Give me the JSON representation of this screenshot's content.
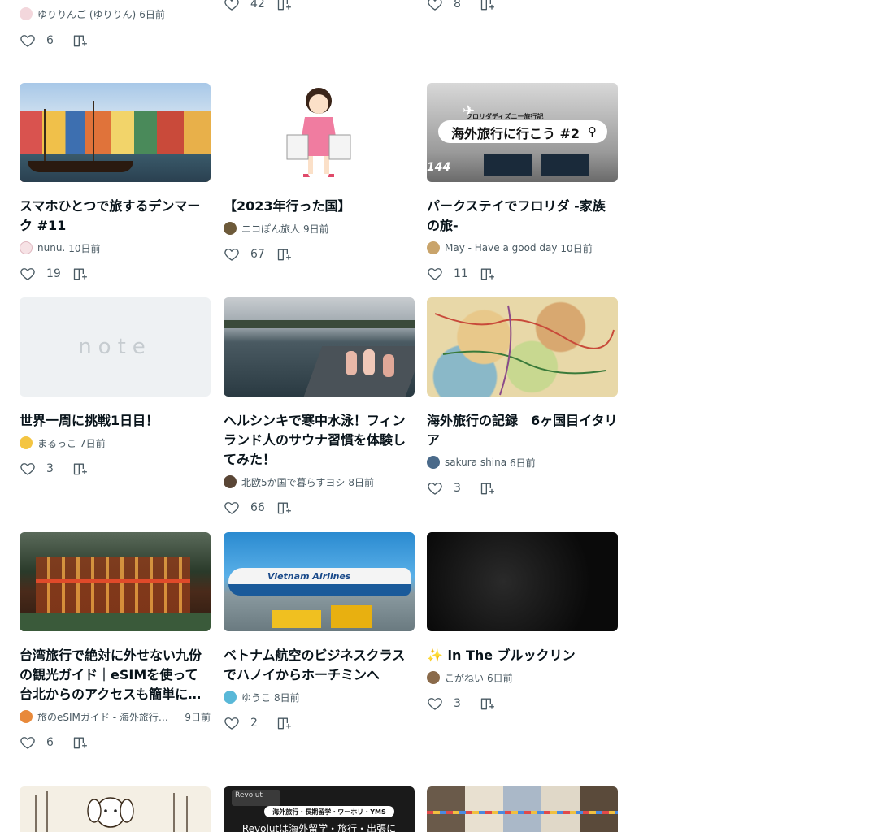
{
  "top_row": [
    {
      "author": "ゆりりんご (ゆりりん)",
      "time": "6日前",
      "likes": "6",
      "avatar_color": "#f3d7dc"
    },
    {
      "likes": "42"
    },
    {
      "likes": "8"
    }
  ],
  "row1": [
    {
      "title": "スマホひとつで旅するデンマーク #11",
      "author": "nunu.",
      "time": "10日前",
      "likes": "19",
      "avatar_color": "#f6e2e5"
    },
    {
      "title": "【2023年行った国】",
      "author": "ニコぽん旅人",
      "time": "9日前",
      "likes": "67",
      "avatar_color": "#6d5a3a"
    },
    {
      "title": "パークステイでフロリダ -家族の旅-",
      "author": "May - Have a good day",
      "time": "10日前",
      "likes": "11",
      "avatar_color": "#c9a46b",
      "thumb_banner": "海外旅行に行こう #2",
      "thumb_small": "フロリダディズニー旅行記",
      "thumb_num": "144"
    }
  ],
  "row2": [
    {
      "title": "世界一周に挑戦1日目！",
      "author": "まるっこ",
      "time": "7日前",
      "likes": "3",
      "avatar_color": "#f4c542",
      "thumb_logo": "note"
    },
    {
      "title": "ヘルシンキで寒中水泳！フィンランド人のサウナ習慣を体験してみた！",
      "author": "北欧5か国で暮らすヨシ",
      "time": "8日前",
      "likes": "66",
      "avatar_color": "#5a4636"
    },
    {
      "title": "海外旅行の記録　6ヶ国目イタリア",
      "author": "sakura shina",
      "time": "6日前",
      "likes": "3",
      "avatar_color": "#4a6a8a"
    }
  ],
  "row3": [
    {
      "title": "台湾旅行で絶対に外せない九份の観光ガイド｜eSIMを使って台北からのアクセスも簡単に解説します",
      "author": "旅のeSIMガイド - 海外旅行でeSIMを使う方法",
      "time": "9日前",
      "likes": "6",
      "avatar_color": "#e8893a"
    },
    {
      "title": "ベトナム航空のビジネスクラスでハノイからホーチミンへ",
      "author": "ゆうこ",
      "time": "8日前",
      "likes": "2",
      "avatar_color": "#59b8d8"
    },
    {
      "title": "✨ in The ブルックリン",
      "author": "こがねい",
      "time": "6日前",
      "likes": "3",
      "avatar_color": "#8a6a4a"
    }
  ],
  "row4": [
    {
      "thumb": "book"
    },
    {
      "thumb_brand": "Revolut",
      "thumb_tag": "海外旅行・長期留学・ワーホリ・YMS",
      "thumb_text": "Revolutは海外留学・旅行・出張に"
    },
    {
      "thumb": "street"
    }
  ]
}
